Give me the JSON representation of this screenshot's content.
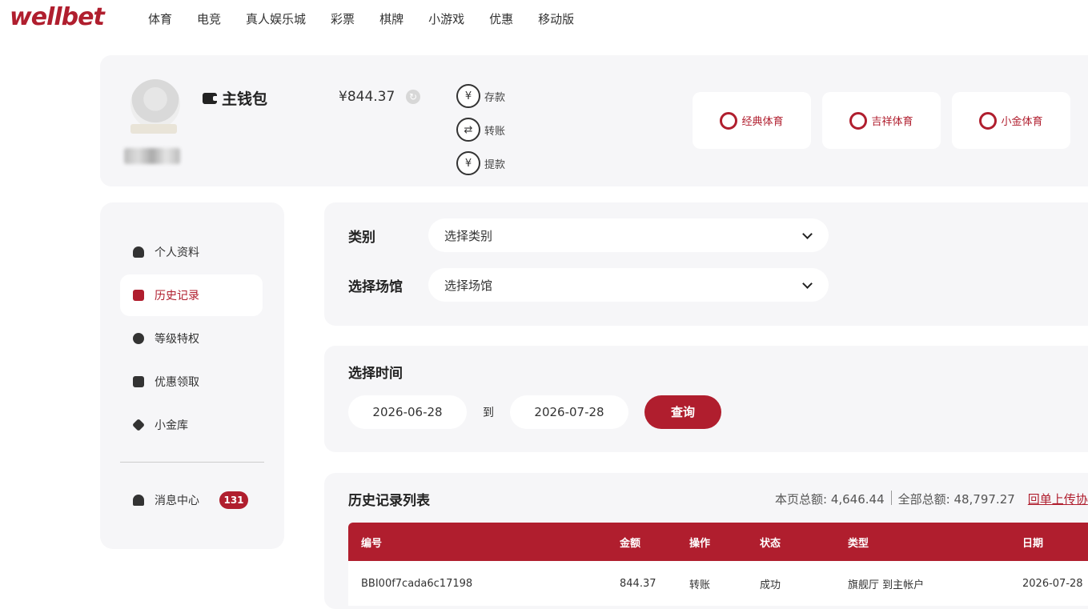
{
  "brand": {
    "logo": "wellbet"
  },
  "nav": [
    "体育",
    "电竞",
    "真人娱乐城",
    "彩票",
    "棋牌",
    "小游戏",
    "优惠",
    "移动版"
  ],
  "wallet": {
    "title": "主钱包",
    "balance": "¥844.37",
    "actions": [
      {
        "label": "存款",
        "icon": "deposit-icon"
      },
      {
        "label": "转账",
        "icon": "transfer-icon"
      },
      {
        "label": "提款",
        "icon": "withdraw-icon"
      }
    ],
    "venues": [
      {
        "label": "经典体育",
        "icon": "classic-sports-icon"
      },
      {
        "label": "吉祥体育",
        "icon": "lucky-sports-icon"
      },
      {
        "label": "小金体育",
        "icon": "xiaojin-sports-icon"
      }
    ]
  },
  "sidebar": {
    "items": [
      {
        "label": "个人资料",
        "icon": "user-icon"
      },
      {
        "label": "历史记录",
        "icon": "history-icon"
      },
      {
        "label": "等级特权",
        "icon": "medal-icon"
      },
      {
        "label": "优惠领取",
        "icon": "gift-icon"
      },
      {
        "label": "小金库",
        "icon": "diamond-icon"
      }
    ],
    "messages": {
      "label": "消息中心",
      "count": "131",
      "icon": "bell-icon"
    }
  },
  "filters": {
    "category": {
      "label": "类别",
      "placeholder": "选择类别"
    },
    "venue": {
      "label": "选择场馆",
      "placeholder": "选择场馆"
    }
  },
  "time": {
    "title": "选择时间",
    "from": "2026-06-28",
    "to_label": "到",
    "to": "2026-07-28",
    "query": "查询"
  },
  "history": {
    "title": "历史记录列表",
    "page_total": "本页总额: 4,646.44",
    "all_total": "全部总额: 48,797.27",
    "link": "回单上传协",
    "columns": [
      "编号",
      "金额",
      "操作",
      "状态",
      "类型",
      "日期"
    ],
    "rows": [
      [
        "BBI00f7cada6c17198",
        "844.37",
        "转账",
        "成功",
        "旗舰厅 到主帐户",
        "2026-07-28"
      ]
    ]
  },
  "colors": {
    "accent": "#b01e2e",
    "panel": "#f6f6f8"
  }
}
